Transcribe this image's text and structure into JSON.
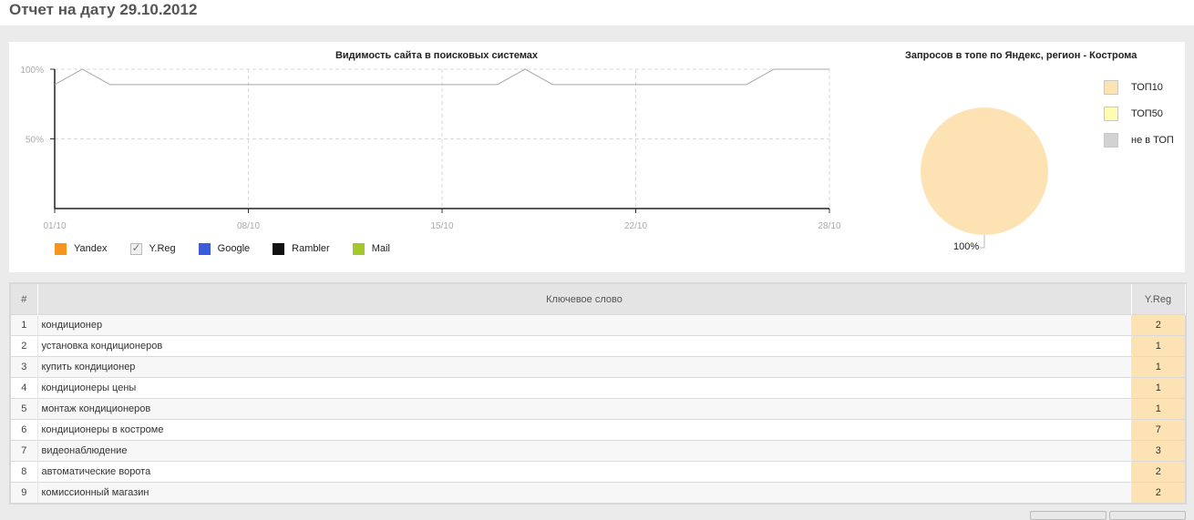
{
  "page": {
    "title": "Отчет на дату 29.10.2012"
  },
  "colors": {
    "yandex": "#f7941d",
    "yreg": "#b0b0b0",
    "google": "#3b5bdb",
    "rambler": "#111111",
    "mail": "#a3c72d",
    "top10": "#fde3b3",
    "top50": "#fffbb0",
    "not_top": "#d2d2d2",
    "line": "#a8a8a8",
    "grid": "#d8d8d8"
  },
  "visibility_chart": {
    "title": "Видимость сайта в поисковых системах",
    "legend": [
      {
        "label": "Yandex",
        "color": "#f7941d",
        "checkbox": false
      },
      {
        "label": "Y.Reg",
        "color": "#b0b0b0",
        "checkbox": true
      },
      {
        "label": "Google",
        "color": "#3b5bdb",
        "checkbox": false
      },
      {
        "label": "Rambler",
        "color": "#111111",
        "checkbox": false
      },
      {
        "label": "Mail",
        "color": "#a3c72d",
        "checkbox": false
      }
    ]
  },
  "chart_data": [
    {
      "type": "line",
      "title": "Видимость сайта в поисковых системах",
      "x_ticks": [
        "01/10",
        "08/10",
        "15/10",
        "22/10",
        "28/10"
      ],
      "y_ticks": [
        "100%",
        "50%"
      ],
      "xlim": [
        1,
        29
      ],
      "ylim": [
        0,
        100
      ],
      "grid": true,
      "legend_placement": "bottom-left",
      "series": [
        {
          "name": "Y.Reg",
          "x": [
            1,
            2,
            3,
            17,
            18,
            19,
            26,
            27,
            29
          ],
          "y": [
            89,
            100,
            89,
            89,
            100,
            89,
            89,
            100,
            100
          ]
        }
      ]
    },
    {
      "type": "pie",
      "title": "Запросов в топе по Яндекс, регион - Кострома",
      "labels": [
        "ТОП10",
        "ТОП50",
        "не в ТОП"
      ],
      "values": [
        100,
        0,
        0
      ],
      "data_labels": [
        "100%"
      ],
      "legend_placement": "top-right"
    }
  ],
  "pie_chart": {
    "title": "Запросов в топе по Яндекс, регион - Кострома",
    "legend": [
      {
        "label": "ТОП10",
        "color": "#fde3b3"
      },
      {
        "label": "ТОП50",
        "color": "#fffbb0"
      },
      {
        "label": "не в ТОП",
        "color": "#d2d2d2"
      }
    ],
    "value_label": "100%"
  },
  "table": {
    "headers": {
      "num": "#",
      "keyword": "Ключевое слово",
      "value": "Y.Reg"
    },
    "rows": [
      {
        "num": "1",
        "keyword": "кондиционер",
        "value": "2"
      },
      {
        "num": "2",
        "keyword": "установка кондиционеров",
        "value": "1"
      },
      {
        "num": "3",
        "keyword": "купить кондиционер",
        "value": "1"
      },
      {
        "num": "4",
        "keyword": "кондиционеры цены",
        "value": "1"
      },
      {
        "num": "5",
        "keyword": "монтаж кондиционеров",
        "value": "1"
      },
      {
        "num": "6",
        "keyword": "кондиционеры в костроме",
        "value": "7"
      },
      {
        "num": "7",
        "keyword": "видеонаблюдение",
        "value": "3"
      },
      {
        "num": "8",
        "keyword": "автоматические ворота",
        "value": "2"
      },
      {
        "num": "9",
        "keyword": "комиссионный магазин",
        "value": "2"
      }
    ]
  }
}
